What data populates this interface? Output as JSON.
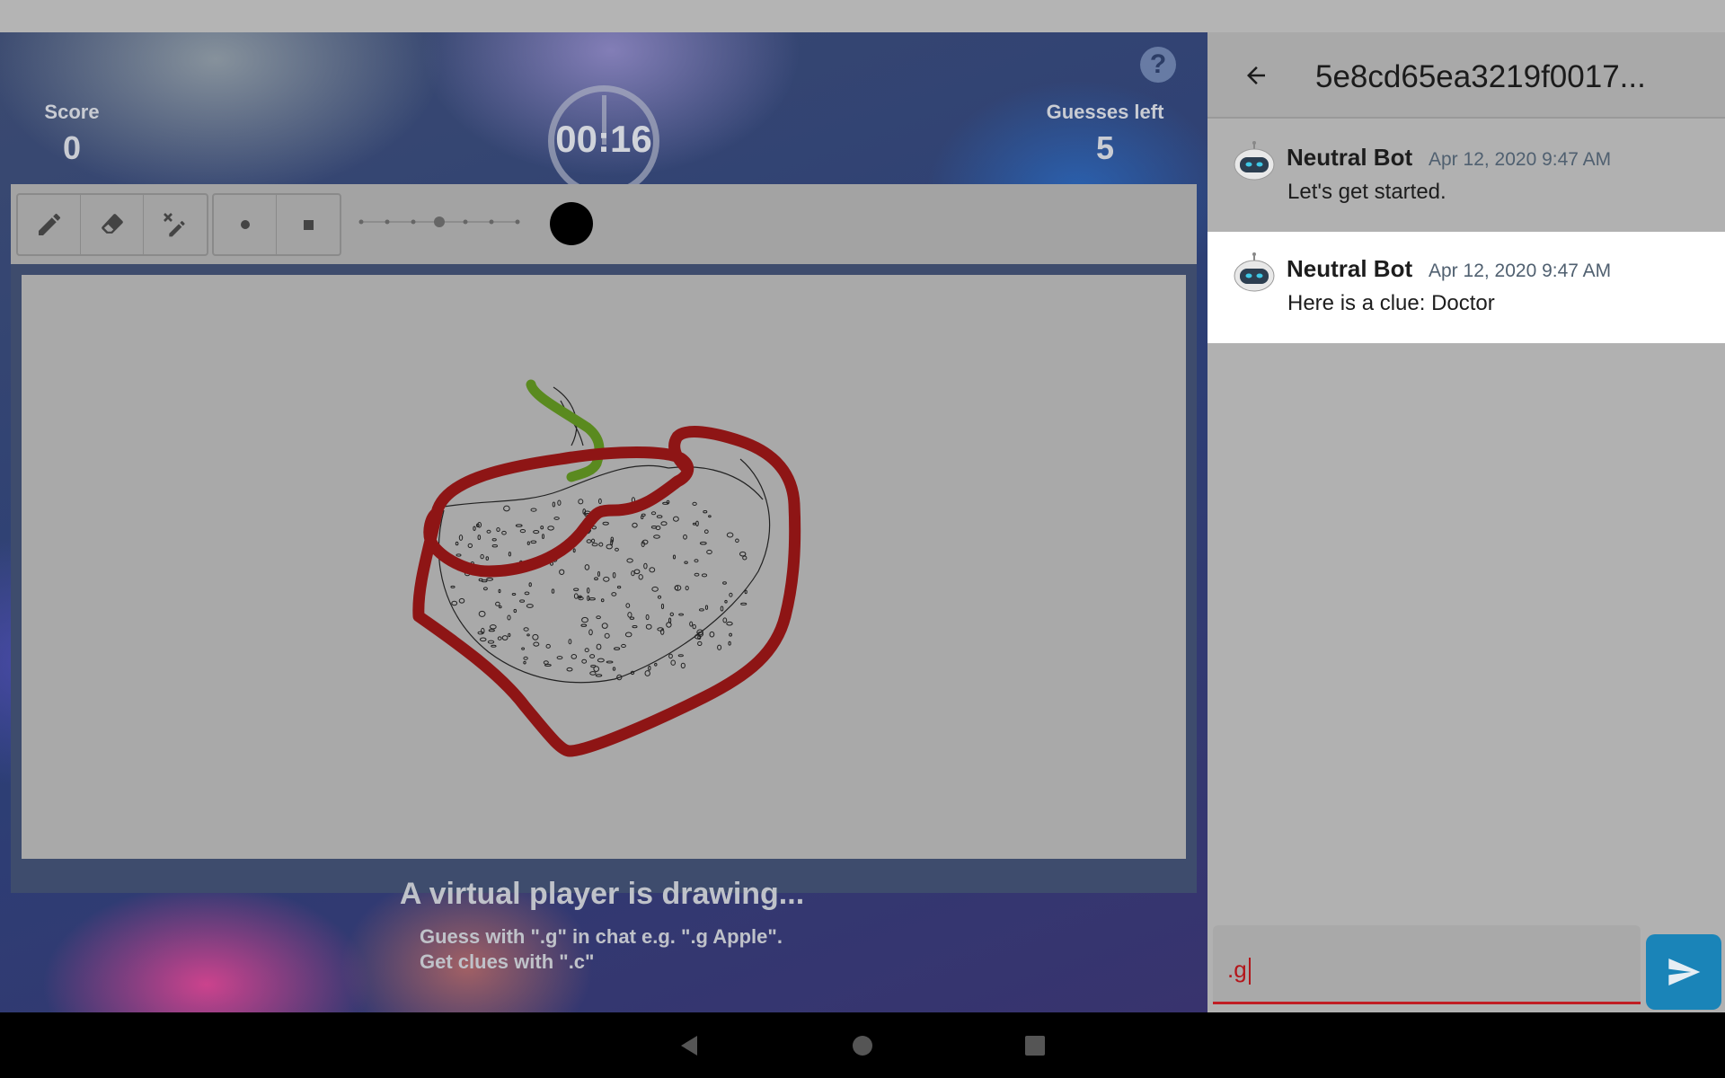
{
  "game": {
    "score_label": "Score",
    "score_value": "0",
    "timer": "00:16",
    "guesses_label": "Guesses left",
    "guesses_value": "5",
    "help_label": "?",
    "toolbar": {
      "tools": [
        {
          "name": "pencil-tool",
          "icon": "pencil-icon"
        },
        {
          "name": "eraser-tool",
          "icon": "eraser-icon"
        },
        {
          "name": "stroke-eraser-tool",
          "icon": "stroke-eraser-icon"
        }
      ],
      "tip_shapes": [
        {
          "name": "round-tip",
          "icon": "circle-icon"
        },
        {
          "name": "square-tip",
          "icon": "square-icon"
        }
      ],
      "brush_size_level": 4,
      "brush_size_steps": 7,
      "selected_color": "#000000"
    },
    "status_title": "A virtual player is drawing...",
    "hint_line_1": "Guess with \".g\" in chat e.g. \".g Apple\".",
    "hint_line_2": "Get clues with \".c\""
  },
  "chat": {
    "title": "5e8cd65ea3219f0017...",
    "messages": [
      {
        "author": "Neutral Bot",
        "time": "Apr 12, 2020 9:47 AM",
        "text": "Let's get started."
      },
      {
        "author": "Neutral Bot",
        "time": "Apr 12, 2020 9:47 AM",
        "text": "Here is a clue: Doctor"
      }
    ],
    "input_value": ".g",
    "accent_color": "#c01e24",
    "send_color": "#1a84b8"
  }
}
